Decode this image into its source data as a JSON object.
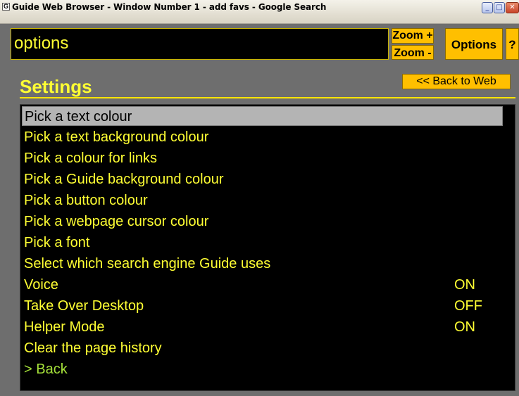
{
  "window": {
    "icon": "G",
    "title": "Guide Web Browser - Window Number 1 - add favs - Google Search",
    "minimize": "_",
    "maximize": "□",
    "close": "✕"
  },
  "address": {
    "value": "options"
  },
  "toolbar": {
    "zoom_in": "Zoom +",
    "zoom_out": "Zoom -",
    "options": "Options",
    "help": "?"
  },
  "settings": {
    "title": "Settings",
    "back_to_web": "<< Back to Web",
    "items": [
      {
        "label": "Pick a text colour",
        "value": ""
      },
      {
        "label": "Pick a text background colour",
        "value": ""
      },
      {
        "label": "Pick a colour for links",
        "value": ""
      },
      {
        "label": "Pick a Guide background colour",
        "value": ""
      },
      {
        "label": "Pick a button colour",
        "value": ""
      },
      {
        "label": "Pick a webpage cursor colour",
        "value": ""
      },
      {
        "label": "Pick a font",
        "value": ""
      },
      {
        "label": "Select which search engine Guide uses",
        "value": ""
      },
      {
        "label": "Voice",
        "value": "ON"
      },
      {
        "label": "Take Over Desktop",
        "value": "OFF"
      },
      {
        "label": "Helper Mode",
        "value": "ON"
      },
      {
        "label": "Clear the page history",
        "value": ""
      },
      {
        "label": "> Back",
        "value": ""
      }
    ]
  }
}
